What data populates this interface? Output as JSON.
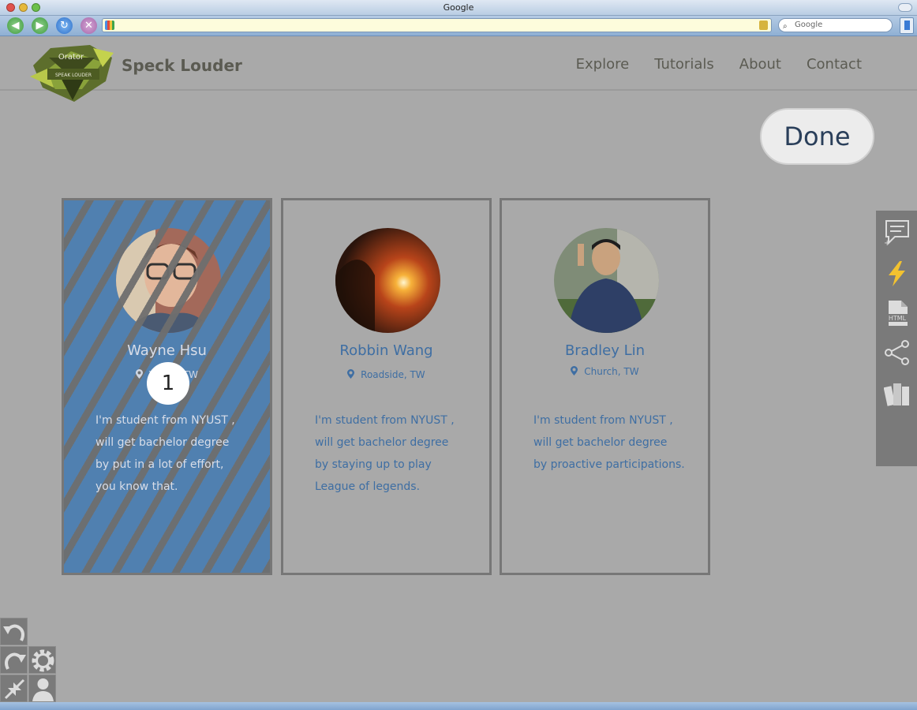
{
  "browser": {
    "window_title": "Google",
    "search_placeholder": "Google",
    "url": ""
  },
  "site": {
    "logo_text_top": "Orator",
    "logo_text_band": "SPEAK LOUDER",
    "brand": "Speck Louder",
    "nav": [
      "Explore",
      "Tutorials",
      "About",
      "Contact"
    ]
  },
  "done_label": "Done",
  "step_badge": "1",
  "cards": [
    {
      "name": "Wayne Hsu",
      "location": "Yunlin, TW",
      "bio": "I'm student from NYUST ,\nwill get bachelor degree\nby put in a lot of effort,\nyou know that.",
      "selected": true
    },
    {
      "name": "Robbin Wang",
      "location": "Roadside, TW",
      "bio": "I'm student from NYUST ,\nwill get bachelor degree\nby staying up to play\nLeague of legends.",
      "selected": false
    },
    {
      "name": "Bradley Lin",
      "location": "Church, TW",
      "bio": "I'm student from NYUST ,\nwill get bachelor degree\nby proactive participations.",
      "selected": false
    }
  ],
  "side_panel_icons": [
    "add-note-icon",
    "lightning-icon",
    "html-file-icon",
    "share-icon",
    "library-icon"
  ],
  "bottom_tool_icons": [
    "undo-icon",
    "redo-icon",
    "settings-icon",
    "collapse-icon",
    "user-icon"
  ],
  "colors": {
    "accent_blue": "#3e6ea3",
    "selected_card": "#5080b0",
    "lightning": "#f2c230"
  }
}
